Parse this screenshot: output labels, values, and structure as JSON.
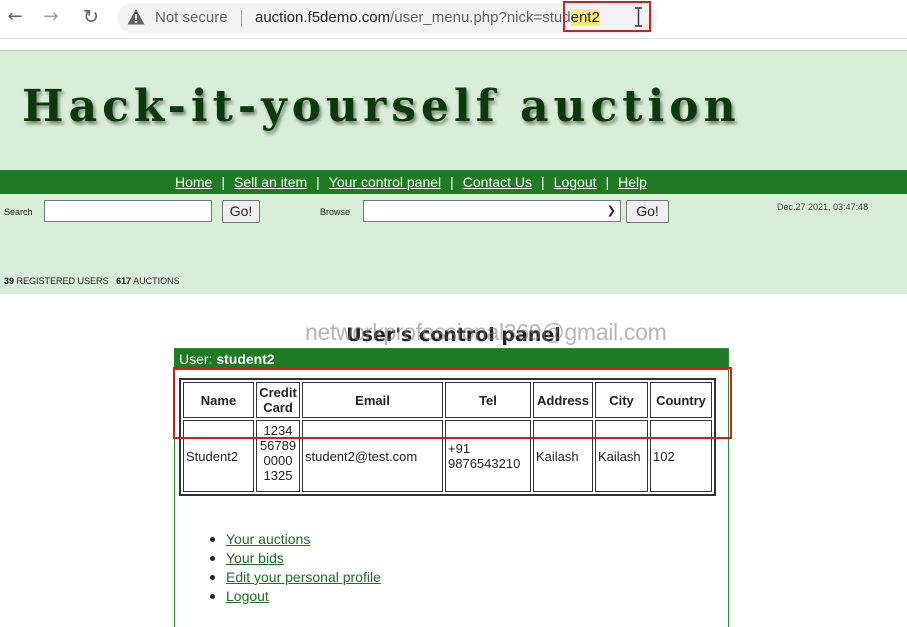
{
  "browser": {
    "security_label": "Not secure",
    "url_host": "auction.f5demo.com",
    "url_path": "/user_menu.php?nick=",
    "url_param_plain": "stud",
    "url_param_highlight": "ent2",
    "icons": [
      "back-arrow-icon",
      "forward-arrow-icon",
      "reload-icon",
      "warning-icon",
      "text-cursor-icon"
    ]
  },
  "site": {
    "logo_text": "Hack-it-yourself auction",
    "menu": [
      {
        "label": "Home"
      },
      {
        "label": "Sell an item"
      },
      {
        "label": "Your control panel"
      },
      {
        "label": "Contact Us"
      },
      {
        "label": "Logout"
      },
      {
        "label": "Help"
      }
    ],
    "search_label": "Search",
    "search_value": "",
    "search_go": "Go!",
    "browse_label": "Browse",
    "browse_selected": "",
    "browse_go": "Go!",
    "date": "Dec.27 2021, 03:47:48",
    "stats": {
      "users_count": "39",
      "users_label": "REGISTERED USERS",
      "auctions_count": "617",
      "auctions_label": "AUCTIONS"
    }
  },
  "control_panel": {
    "title": "User's control panel",
    "user_prefix": "User:",
    "user_name": "student2",
    "columns": [
      "Name",
      "Credit Card",
      "Email",
      "Tel",
      "Address",
      "City",
      "Country"
    ],
    "row": {
      "name": "Student2",
      "credit_card": "1234 56789 0000 1325",
      "email": "student2@test.com",
      "tel": "+91 9876543210",
      "address": "Kailash",
      "city": "Kailash",
      "country": "102"
    },
    "links": [
      "Your auctions",
      "Your bids",
      "Edit your personal profile",
      "Logout"
    ]
  },
  "overlay": {
    "watermark": "networkprofessional369@gmail.com"
  },
  "colors": {
    "site_green": "#1f7a24",
    "banner_bg": "#d9eed8",
    "highlight_red": "#d11f1f",
    "url_highlight": "#fce97a"
  }
}
